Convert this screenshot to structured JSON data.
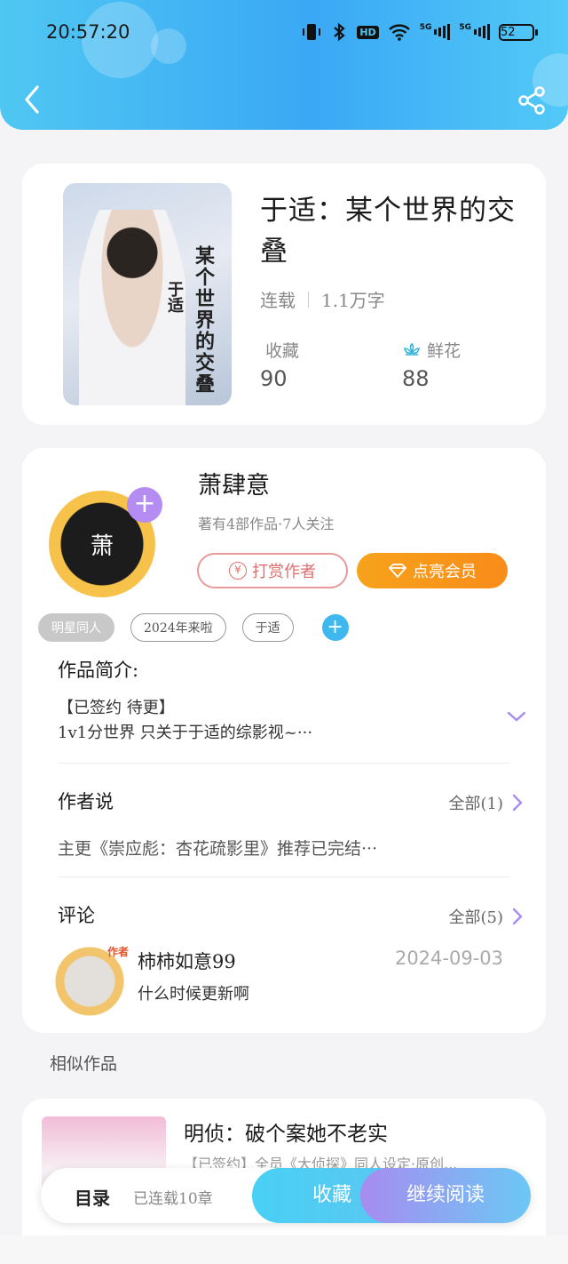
{
  "status_bar": {
    "time": "20:57:20",
    "hd_label": "HD",
    "sim1_label": "5G",
    "sim2_label": "5G",
    "battery": "52"
  },
  "colors": {
    "header_gradient_start": "#4fc7f2",
    "header_gradient_end": "#3aa8f5",
    "vip_orange": "#f7a21b",
    "reward_red": "#e06e6e",
    "follow_purple": "#b48cf2",
    "tag_add_blue": "#3fb8f0"
  },
  "header": {
    "back_icon": "chevron-left-icon",
    "share_icon": "share-icon"
  },
  "book": {
    "cover_text_main": "某个世界的交叠",
    "cover_text_side": "于适",
    "title": "于适：某个世界的交叠",
    "status": "连载",
    "word_count": "1.1万字",
    "favorites_label": "收藏",
    "favorites_value": "90",
    "flowers_label": "鲜花",
    "flowers_value": "88",
    "flower_icon": "flower-icon"
  },
  "author": {
    "avatar_text": "萧",
    "name": "萧肆意",
    "stats": "著有4部作品·7人关注",
    "reward_label": "打赏作者",
    "vip_label": "点亮会员"
  },
  "tags": [
    "明星同人",
    "2024年来啦",
    "于适"
  ],
  "intro": {
    "title": "作品简介:",
    "line1": "【已签约 待更】",
    "line2": "1v1分世界 只关于于适的综影视~···"
  },
  "author_say": {
    "title": "作者说",
    "all_link": "全部(1)",
    "text": "主更《崇应彪：杏花疏影里》推荐已完结···"
  },
  "comments": {
    "title": "评论",
    "all_link": "全部(5)",
    "items": [
      {
        "badge": "作者",
        "user": "柿柿如意99",
        "date": "2024-09-03",
        "text": "什么时候更新啊"
      }
    ]
  },
  "similar": {
    "title": "相似作品",
    "items": [
      {
        "name": "明侦：破个案她不老实",
        "desc": "【已签约】全员《大侦探》同人设定·原创..."
      }
    ]
  },
  "bottom_bar": {
    "toc_label": "目录",
    "toc_count": "已连载10章",
    "favorite_button": "收藏",
    "continue_button": "继续阅读"
  }
}
